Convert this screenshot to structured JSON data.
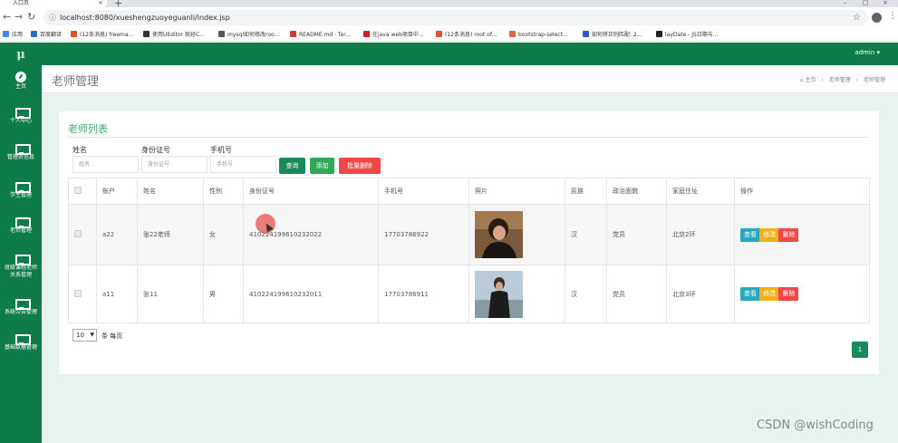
{
  "browser": {
    "tab_title": "入口页",
    "url": "localhost:8080/xueshengzuoyeguanli/index.jsp",
    "bookmarks": [
      {
        "label": "应用",
        "color": "#4285f4"
      },
      {
        "label": "百度翻译",
        "color": "#2b6fd1"
      },
      {
        "label": "(12条消息) freema...",
        "color": "#e0542c"
      },
      {
        "label": "使用UEditor 就经C...",
        "color": "#333333"
      },
      {
        "label": "mysql如何修改roo...",
        "color": "#555555"
      },
      {
        "label": "README.md · Ter...",
        "color": "#d23b3b"
      },
      {
        "label": "在java web项目中...",
        "color": "#cc2222"
      },
      {
        "label": "(12条消息) root of...",
        "color": "#e0542c"
      },
      {
        "label": "bootstrap-select...",
        "color": "#e06a3c"
      },
      {
        "label": "如何将正则匹配: 2...",
        "color": "#3355cc"
      },
      {
        "label": "layDate - JS日期与...",
        "color": "#222222"
      }
    ]
  },
  "sidebar": {
    "logo": "μ",
    "items": [
      {
        "label": "主页",
        "icon": "dashboard-icon"
      },
      {
        "label": "个人中心",
        "icon": "monitor-icon"
      },
      {
        "label": "管理员信息",
        "icon": "monitor-icon"
      },
      {
        "label": "学生管理",
        "icon": "monitor-icon"
      },
      {
        "label": "老师管理",
        "icon": "monitor-icon"
      },
      {
        "label": "班级课程老师",
        "label2": "关系管理",
        "icon": "monitor-icon"
      },
      {
        "label": "系统公告管理",
        "icon": "monitor-icon"
      },
      {
        "label": "基础数据管理",
        "icon": "monitor-icon"
      }
    ]
  },
  "topnav": {
    "user": "admin ▾"
  },
  "page": {
    "title": "老师管理",
    "breadcrumb": {
      "home": "主页",
      "sep": "›",
      "parent": "老师管理",
      "current": "老师管理"
    }
  },
  "card": {
    "title": "老师列表"
  },
  "filters": {
    "name_label": "姓名",
    "name_placeholder": "姓名",
    "idcard_label": "身份证号",
    "idcard_placeholder": "身份证号",
    "phone_label": "手机号",
    "phone_placeholder": "手机号",
    "search_label": "查询",
    "add_label": "添加",
    "batch_delete_label": "批量删除"
  },
  "table": {
    "columns": [
      "",
      "账户",
      "姓名",
      "性别",
      "身份证号",
      "手机号",
      "照片",
      "民族",
      "政治面貌",
      "家庭住址",
      "操作"
    ],
    "rows": [
      {
        "account": "a22",
        "name": "张22老师",
        "gender": "女",
        "idcard": "410224199610232022",
        "phone": "17703786922",
        "ethnic": "汉",
        "political": "党员",
        "address": "北京2环"
      },
      {
        "account": "a11",
        "name": "张11",
        "gender": "男",
        "idcard": "410224199610232011",
        "phone": "17703786911",
        "ethnic": "汉",
        "political": "党员",
        "address": "北京3环"
      }
    ],
    "actions": {
      "view": "查看",
      "edit": "修改",
      "delete": "删除"
    }
  },
  "pager": {
    "size": "10",
    "size_label": "条 每页",
    "current_page": "1"
  },
  "watermark": "CSDN @wishCoding",
  "colors": {
    "brand_green": "#0f7b48",
    "title_green": "#3fa967",
    "search_btn": "#1a8a5a",
    "add_btn": "#2eaa55",
    "delete_btn": "#f04848",
    "view_btn": "#2aa8c0",
    "edit_btn": "#f3b01a"
  }
}
